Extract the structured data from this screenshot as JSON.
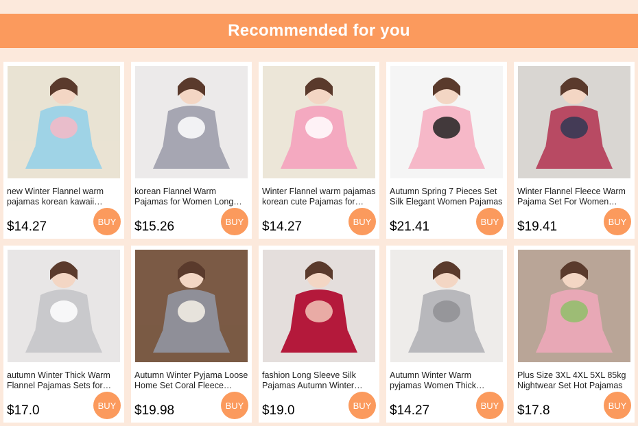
{
  "header": {
    "title": "Recommended for you"
  },
  "buy_label": "BUY",
  "colors": {
    "accent": "#fb9a5d",
    "background": "#fce9dc"
  },
  "products": [
    {
      "title": "new Winter Flannel warm pajamas korean kawaii cartoon Pajamas for Women",
      "price": "$14.27",
      "image": {
        "bg": "#e9e3d3",
        "garment": "#9fd3e6",
        "accent": "#f6b9c6"
      }
    },
    {
      "title": "korean Flannel Warm Pajamas for Women Long Sleeve Sleepwear",
      "price": "$15.26",
      "image": {
        "bg": "#eceaea",
        "garment": "#a6a6b2",
        "accent": "#ffffff"
      }
    },
    {
      "title": "Winter Flannel warm pajamas korean cute Pajamas for Women",
      "price": "$14.27",
      "image": {
        "bg": "#ece6d8",
        "garment": "#f4a9c0",
        "accent": "#ffffff"
      }
    },
    {
      "title": "Autumn Spring 7 Pieces Set Silk Elegant Women Pajamas",
      "price": "$21.41",
      "image": {
        "bg": "#f5f5f5",
        "garment": "#f6b8c8",
        "accent": "#222222"
      }
    },
    {
      "title": "Winter Flannel Fleece Warm Pajama Set For Women Couple",
      "price": "$19.41",
      "image": {
        "bg": "#d9d6d2",
        "garment": "#b84a63",
        "accent": "#2f3854"
      }
    },
    {
      "title": "autumn Winter Thick Warm Flannel Pajamas Sets for Women",
      "price": "$17.0",
      "image": {
        "bg": "#e8e6e6",
        "garment": "#c9c9cc",
        "accent": "#ffffff"
      }
    },
    {
      "title": "Autumn Winter Pyjama Loose Home Set Coral Fleece Women",
      "price": "$19.98",
      "image": {
        "bg": "#7b5a45",
        "garment": "#8f8f98",
        "accent": "#f7f2e8"
      }
    },
    {
      "title": "fashion Long Sleeve Silk Pajamas Autumn Winter Sleepwear",
      "price": "$19.0",
      "image": {
        "bg": "#e4dedc",
        "garment": "#b4193b",
        "accent": "#f2c6b9"
      }
    },
    {
      "title": "Autumn Winter Warm pyjamas Women Thick Flannel Totoro",
      "price": "$14.27",
      "image": {
        "bg": "#eeecea",
        "garment": "#b8b8bc",
        "accent": "#8f8f94"
      }
    },
    {
      "title": "Plus Size 3XL 4XL 5XL 85kg Nightwear Set Hot Pajamas",
      "price": "$17.8",
      "image": {
        "bg": "#b9a597",
        "garment": "#e8a8b6",
        "accent": "#8fbf6a"
      }
    }
  ]
}
